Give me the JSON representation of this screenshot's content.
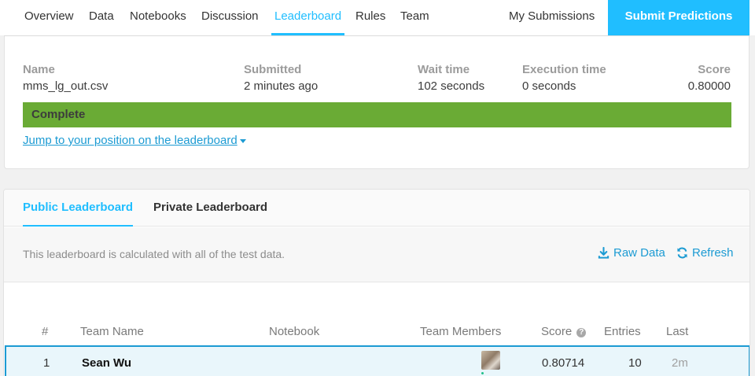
{
  "nav": {
    "tabs": [
      "Overview",
      "Data",
      "Notebooks",
      "Discussion",
      "Leaderboard",
      "Rules",
      "Team"
    ],
    "active_tab": "Leaderboard",
    "my_submissions": "My Submissions",
    "submit_button": "Submit Predictions",
    "accent_color": "#20beff"
  },
  "submission": {
    "name_label": "Name",
    "name_value": "mms_lg_out.csv",
    "submitted_label": "Submitted",
    "submitted_value": "2 minutes ago",
    "wait_label": "Wait time",
    "wait_value": "102 seconds",
    "exec_label": "Execution time",
    "exec_value": "0 seconds",
    "score_label": "Score",
    "score_value": "0.80000",
    "status": "Complete",
    "status_color": "#6aab35",
    "jump_link": "Jump to your position on the leaderboard",
    "jump_icon": "caret-down-icon"
  },
  "leaderboard": {
    "tabs": [
      "Public Leaderboard",
      "Private Leaderboard"
    ],
    "active_tab": "Public Leaderboard",
    "info_text": "This leaderboard is calculated with all of the test data.",
    "raw_data": "Raw Data",
    "raw_data_icon": "download-icon",
    "refresh": "Refresh",
    "refresh_icon": "refresh-icon",
    "columns": [
      "#",
      "Team Name",
      "Notebook",
      "Team Members",
      "Score",
      "Entries",
      "Last"
    ],
    "score_help_icon": "help-icon",
    "rows": [
      {
        "rank": "1",
        "team": "Sean Wu",
        "notebook": "",
        "score": "0.80714",
        "entries": "10",
        "last": "2m"
      }
    ]
  }
}
